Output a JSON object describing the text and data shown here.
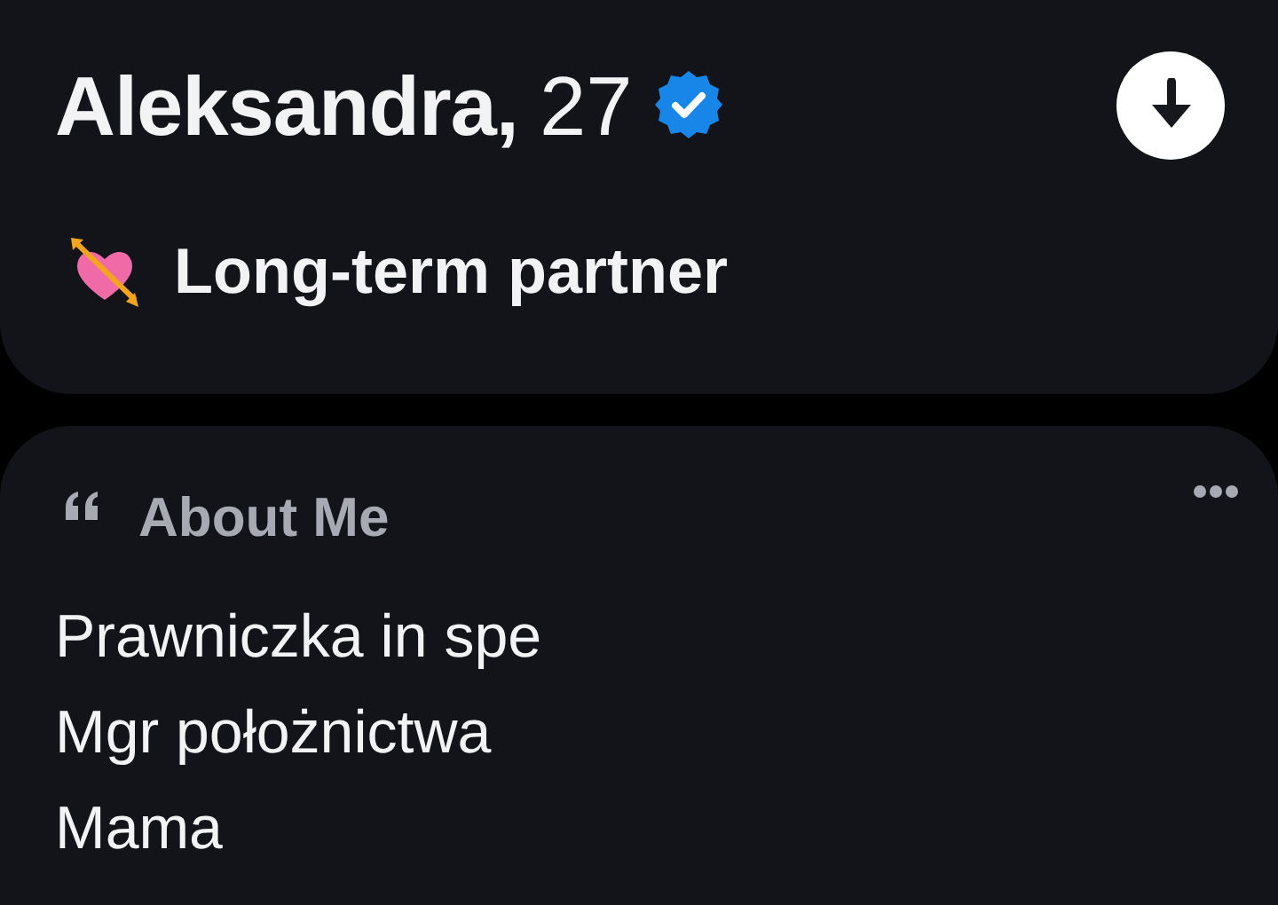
{
  "profile": {
    "name": "Aleksandra,",
    "age": "27",
    "verified": true,
    "looking_for": "Long-term partner"
  },
  "about": {
    "heading": "About Me",
    "lines": [
      "Prawniczka in spe",
      "Mgr położnictwa",
      "Mama"
    ]
  }
}
